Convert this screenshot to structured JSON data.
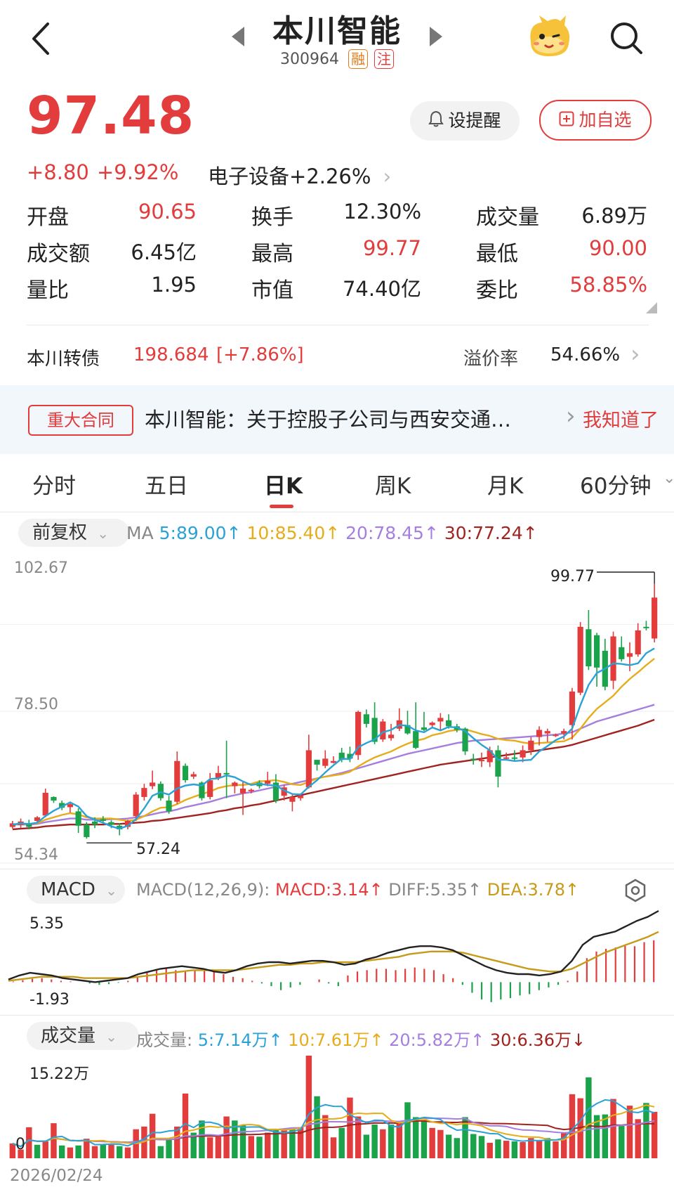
{
  "header": {
    "title": "本川智能",
    "code": "300964",
    "tag_margin": "融",
    "tag_note": "注"
  },
  "price": {
    "last": "97.48",
    "change": "+8.80",
    "change_pct": "+9.92%",
    "sector": "电子设备",
    "sector_pct": "+2.26%"
  },
  "buttons": {
    "remind": "设提醒",
    "add": "加自选"
  },
  "stats": [
    {
      "label": "开盘",
      "value": "90.65",
      "color": "red"
    },
    {
      "label": "换手",
      "value": "12.30%",
      "color": "black"
    },
    {
      "label": "成交量",
      "value": "6.89万",
      "color": "black"
    },
    {
      "label": "成交额",
      "value": "6.45亿",
      "color": "black"
    },
    {
      "label": "最高",
      "value": "99.77",
      "color": "red"
    },
    {
      "label": "最低",
      "value": "90.00",
      "color": "red"
    },
    {
      "label": "量比",
      "value": "1.95",
      "color": "black"
    },
    {
      "label": "市值",
      "value": "74.40亿",
      "color": "black"
    },
    {
      "label": "委比",
      "value": "58.85%",
      "color": "red"
    }
  ],
  "bond": {
    "name": "本川转债",
    "price": "198.684",
    "pct": "[+7.86%]",
    "premium_label": "溢价率",
    "premium": "54.66%"
  },
  "notice": {
    "tag": "重大合同",
    "text": "本川智能：关于控股子公司与西安交通…",
    "action": "我知道了"
  },
  "tabs": [
    "分时",
    "五日",
    "日K",
    "周K",
    "月K",
    "60分钟"
  ],
  "kline": {
    "adjust": "前复权",
    "ma_label": "MA",
    "ma5": "5:89.00",
    "ma10": "10:85.40",
    "ma20": "20:78.45",
    "ma30": "30:77.24",
    "y_top": "102.67",
    "y_mid": "78.50",
    "y_bot": "54.34",
    "hi_label": "99.77",
    "lo_label": "57.24"
  },
  "macd": {
    "dropdown": "MACD",
    "params": "MACD(12,26,9):",
    "macd_val": "MACD:3.14",
    "diff_val": "DIFF:5.35",
    "dea_val": "DEA:3.78",
    "y_top": "5.35",
    "y_bot": "-1.93"
  },
  "volume": {
    "dropdown": "成交量",
    "label": "成交量:",
    "v5": "5:7.14万",
    "v10": "10:7.61万",
    "v20": "20:5.82万",
    "v30": "30:6.36万",
    "y_top": "15.22万",
    "y_bot": "0",
    "date": "2026/02/24"
  },
  "colors": {
    "up": "#e23c3c",
    "down": "#1aa34a",
    "ma5": "#2aa2d6",
    "ma10": "#e6ac1a",
    "ma20": "#a57fe0",
    "ma30": "#a0231f"
  },
  "chart_data": {
    "type": "candlestick",
    "ylim": [
      54.34,
      102.67
    ],
    "annotations": {
      "high": 99.77,
      "low": 57.24
    },
    "candles": [
      [
        59.2,
        59.8,
        58.9,
        60.2
      ],
      [
        59.5,
        60.1,
        59.0,
        60.6
      ],
      [
        59.8,
        59.2,
        58.8,
        60.4
      ],
      [
        60.2,
        60.8,
        59.8,
        61.0
      ],
      [
        61.1,
        64.9,
        60.8,
        65.6
      ],
      [
        64.2,
        63.6,
        63.2,
        64.3
      ],
      [
        63.2,
        62.4,
        62.0,
        63.6
      ],
      [
        62.5,
        63.0,
        61.6,
        63.4
      ],
      [
        61.8,
        59.4,
        58.2,
        62.3
      ],
      [
        59.6,
        57.5,
        57.24,
        60.0
      ],
      [
        60.1,
        59.6,
        59.0,
        60.8
      ],
      [
        60.5,
        60.2,
        59.8,
        61.0
      ],
      [
        60.0,
        59.6,
        59.0,
        60.3
      ],
      [
        59.4,
        58.8,
        57.8,
        59.8
      ],
      [
        59.2,
        60.2,
        58.8,
        60.4
      ],
      [
        61.0,
        64.6,
        60.2,
        65.0
      ],
      [
        64.2,
        65.7,
        63.6,
        66.4
      ],
      [
        66.0,
        66.6,
        65.5,
        68.6
      ],
      [
        66.4,
        64.0,
        63.6,
        66.8
      ],
      [
        63.6,
        61.8,
        61.4,
        64.4
      ],
      [
        63.4,
        70.2,
        63.0,
        71.8
      ],
      [
        69.4,
        67.0,
        66.6,
        69.8
      ],
      [
        67.6,
        68.0,
        67.2,
        68.4
      ],
      [
        66.6,
        64.0,
        63.6,
        66.8
      ],
      [
        64.2,
        67.0,
        63.8,
        68.2
      ],
      [
        67.4,
        68.2,
        67.0,
        69.4
      ],
      [
        68.2,
        68.0,
        64.0,
        73.6
      ],
      [
        66.0,
        66.6,
        64.8,
        66.8
      ],
      [
        64.8,
        65.6,
        61.2,
        66.8
      ],
      [
        65.2,
        65.4,
        64.8,
        65.6
      ],
      [
        66.6,
        66.0,
        65.6,
        67.0
      ],
      [
        66.4,
        66.9,
        66.0,
        68.4
      ],
      [
        66.6,
        63.6,
        63.2,
        68.0
      ],
      [
        64.4,
        65.8,
        63.6,
        66.2
      ],
      [
        63.4,
        64.2,
        61.8,
        64.8
      ],
      [
        64.0,
        64.4,
        63.6,
        64.8
      ],
      [
        65.8,
        72.0,
        65.6,
        74.6
      ],
      [
        70.4,
        69.6,
        68.6,
        70.4
      ],
      [
        69.4,
        70.6,
        69.0,
        72.0
      ],
      [
        69.9,
        70.2,
        69.8,
        71.0
      ],
      [
        71.6,
        70.4,
        70.0,
        72.4
      ],
      [
        71.4,
        70.6,
        70.0,
        72.6
      ],
      [
        71.2,
        78.4,
        70.4,
        78.6
      ],
      [
        78.0,
        76.4,
        75.8,
        78.8
      ],
      [
        77.4,
        73.4,
        73.0,
        80.0
      ],
      [
        73.8,
        76.8,
        73.4,
        77.2
      ],
      [
        74.0,
        74.6,
        73.6,
        76.4
      ],
      [
        75.6,
        77.0,
        75.2,
        79.0
      ],
      [
        76.2,
        74.8,
        74.6,
        78.6
      ],
      [
        75.2,
        72.4,
        72.2,
        80.0
      ],
      [
        75.8,
        75.4,
        75.2,
        78.4
      ],
      [
        76.2,
        76.6,
        75.8,
        76.8
      ],
      [
        76.8,
        77.4,
        75.2,
        78.2
      ],
      [
        77.0,
        76.0,
        75.6,
        78.0
      ],
      [
        76.0,
        75.4,
        75.0,
        76.4
      ],
      [
        75.6,
        71.8,
        71.2,
        75.8
      ],
      [
        70.6,
        70.4,
        69.6,
        71.4
      ],
      [
        70.4,
        70.4,
        69.2,
        71.6
      ],
      [
        70.0,
        72.0,
        69.2,
        72.6
      ],
      [
        72.0,
        67.6,
        65.8,
        72.8
      ],
      [
        70.6,
        70.8,
        70.4,
        71.6
      ],
      [
        70.8,
        70.6,
        70.2,
        72.0
      ],
      [
        70.8,
        72.0,
        70.0,
        72.8
      ],
      [
        72.0,
        73.6,
        71.2,
        74.2
      ],
      [
        74.2,
        75.4,
        72.8,
        76.0
      ],
      [
        74.8,
        75.2,
        73.4,
        75.6
      ],
      [
        74.4,
        74.6,
        74.2,
        74.8
      ],
      [
        74.8,
        75.2,
        73.8,
        75.6
      ],
      [
        76.2,
        81.8,
        73.8,
        82.4
      ],
      [
        81.6,
        92.6,
        81.2,
        93.4
      ],
      [
        92.2,
        86.0,
        85.4,
        95.4
      ],
      [
        91.2,
        85.8,
        82.6,
        91.6
      ],
      [
        88.6,
        82.6,
        82.0,
        90.6
      ],
      [
        83.6,
        91.0,
        82.2,
        91.8
      ],
      [
        89.2,
        87.2,
        86.8,
        91.0
      ],
      [
        87.6,
        88.2,
        85.2,
        90.0
      ],
      [
        88.0,
        92.0,
        87.6,
        93.2
      ],
      [
        92.6,
        92.4,
        92.0,
        93.6
      ],
      [
        90.65,
        97.48,
        90.0,
        99.77
      ]
    ],
    "ma5": [
      59.6,
      59.8,
      59.7,
      59.9,
      61.0,
      61.9,
      62.6,
      63.3,
      62.6,
      61.0,
      60.4,
      59.9,
      59.3,
      58.9,
      59.4,
      60.5,
      62.3,
      64.4,
      65.0,
      64.6,
      65.6,
      66.1,
      66.3,
      66.1,
      67.2,
      67.3,
      67.8,
      67.5,
      66.8,
      66.2,
      66.4,
      66.2,
      66.1,
      65.3,
      64.7,
      64.6,
      65.9,
      67.0,
      68.3,
      69.5,
      70.6,
      70.5,
      72.5,
      73.2,
      73.8,
      75.0,
      75.4,
      76.2,
      76.1,
      75.3,
      75.0,
      75.8,
      75.3,
      75.9,
      75.8,
      75.2,
      74.0,
      72.9,
      72.0,
      70.4,
      70.4,
      70.2,
      70.3,
      70.4,
      71.8,
      72.7,
      73.7,
      74.3,
      75.6,
      79.5,
      82.9,
      84.9,
      85.6,
      86.5,
      86.4,
      86.2,
      86.5,
      88.2,
      89.0
    ],
    "ma10": [
      59.6,
      59.7,
      59.7,
      59.8,
      60.4,
      60.8,
      61.2,
      61.5,
      61.3,
      60.8,
      60.6,
      60.6,
      60.6,
      60.4,
      60.2,
      60.4,
      61.0,
      61.8,
      62.4,
      62.5,
      63.0,
      63.7,
      64.2,
      64.7,
      65.1,
      65.7,
      66.0,
      66.2,
      66.2,
      66.4,
      66.8,
      66.9,
      67.0,
      66.7,
      66.3,
      66.2,
      66.7,
      67.3,
      67.6,
      67.8,
      68.0,
      68.4,
      69.3,
      70.1,
      70.8,
      71.3,
      71.8,
      72.5,
      73.1,
      73.6,
      73.9,
      74.5,
      74.8,
      75.2,
      75.4,
      75.5,
      75.1,
      74.7,
      74.4,
      73.9,
      73.7,
      73.6,
      73.3,
      73.1,
      73.2,
      73.3,
      73.4,
      73.5,
      74.1,
      75.6,
      77.4,
      78.9,
      80.0,
      81.1,
      82.6,
      83.9,
      85.0,
      86.2,
      87.3
    ],
    "ma20": [
      59.6,
      59.6,
      59.6,
      59.7,
      60.0,
      60.2,
      60.4,
      60.6,
      60.6,
      60.4,
      60.4,
      60.4,
      60.5,
      60.5,
      60.6,
      60.8,
      61.0,
      61.3,
      61.6,
      61.8,
      62.1,
      62.5,
      62.8,
      63.1,
      63.4,
      63.8,
      64.2,
      64.5,
      64.8,
      65.0,
      65.3,
      65.6,
      65.9,
      66.2,
      66.4,
      66.7,
      67.0,
      67.3,
      67.6,
      67.9,
      68.2,
      68.6,
      69.0,
      69.4,
      69.8,
      70.2,
      70.6,
      71.0,
      71.4,
      71.7,
      72.0,
      72.3,
      72.6,
      72.9,
      73.2,
      73.4,
      73.6,
      73.7,
      73.8,
      73.9,
      74.0,
      74.1,
      74.2,
      74.3,
      74.4,
      74.5,
      74.6,
      74.8,
      75.0,
      75.6,
      76.2,
      76.8,
      77.2,
      77.6,
      78.0,
      78.4,
      78.8,
      79.2,
      79.6
    ],
    "ma30": [
      58.8,
      58.9,
      59.0,
      59.1,
      59.3,
      59.4,
      59.5,
      59.6,
      59.6,
      59.6,
      59.6,
      59.6,
      59.7,
      59.7,
      59.8,
      59.9,
      60.0,
      60.2,
      60.3,
      60.5,
      60.7,
      60.9,
      61.1,
      61.3,
      61.5,
      61.8,
      62.0,
      62.3,
      62.5,
      62.8,
      63.0,
      63.3,
      63.6,
      63.9,
      64.2,
      64.5,
      64.8,
      65.1,
      65.4,
      65.7,
      66.0,
      66.3,
      66.6,
      66.9,
      67.2,
      67.5,
      67.8,
      68.1,
      68.4,
      68.7,
      69.0,
      69.3,
      69.6,
      69.8,
      70.0,
      70.2,
      70.4,
      70.6,
      70.8,
      71.0,
      71.2,
      71.4,
      71.6,
      71.8,
      72.0,
      72.2,
      72.4,
      72.6,
      72.9,
      73.3,
      73.7,
      74.1,
      74.5,
      74.9,
      75.3,
      75.7,
      76.1,
      76.6,
      77.1
    ],
    "macd_ylim": [
      -1.93,
      5.35
    ],
    "macd_hist": [
      0.05,
      0.15,
      0.25,
      0.3,
      0.2,
      0.1,
      0.05,
      0.0,
      -0.1,
      -0.2,
      -0.15,
      -0.05,
      0.1,
      0.4,
      0.7,
      0.9,
      1.0,
      0.9,
      0.8,
      0.9,
      1.0,
      0.8,
      0.6,
      0.4,
      0.3,
      0.1,
      -0.1,
      -0.3,
      -0.6,
      -0.4,
      -0.2,
      0.0,
      0.2,
      -0.1,
      -0.3,
      0.5,
      0.8,
      0.9,
      1.0,
      1.0,
      0.9,
      1.0,
      1.1,
      1.0,
      0.9,
      0.6,
      0.3,
      -0.2,
      -0.8,
      -1.3,
      -1.5,
      -1.3,
      -1.2,
      -1.0,
      -0.9,
      -0.6,
      -0.4,
      -0.2,
      0.1,
      0.8,
      1.8,
      2.3,
      2.5,
      2.6,
      2.8,
      2.7,
      3.0,
      3.14
    ],
    "diff": [
      0.2,
      0.5,
      0.7,
      0.6,
      0.5,
      0.3,
      0.2,
      0.1,
      0.0,
      0.1,
      0.2,
      0.3,
      0.6,
      0.8,
      1.0,
      1.1,
      1.2,
      1.1,
      1.0,
      0.8,
      0.7,
      0.9,
      1.2,
      1.4,
      1.5,
      1.5,
      1.4,
      1.5,
      1.6,
      1.6,
      1.5,
      1.3,
      1.4,
      1.7,
      1.9,
      2.2,
      2.4,
      2.6,
      2.7,
      2.7,
      2.6,
      2.4,
      2.0,
      1.6,
      1.2,
      0.9,
      0.7,
      0.6,
      0.6,
      0.5,
      0.6,
      0.8,
      1.6,
      2.8,
      3.4,
      3.6,
      3.8,
      4.2,
      4.6,
      4.9,
      5.35
    ],
    "dea": [
      0.1,
      0.2,
      0.3,
      0.4,
      0.4,
      0.4,
      0.4,
      0.3,
      0.3,
      0.3,
      0.3,
      0.3,
      0.4,
      0.5,
      0.6,
      0.7,
      0.8,
      0.9,
      0.9,
      0.9,
      0.9,
      0.9,
      1.0,
      1.1,
      1.2,
      1.3,
      1.3,
      1.4,
      1.4,
      1.5,
      1.5,
      1.5,
      1.5,
      1.6,
      1.7,
      1.8,
      1.9,
      2.1,
      2.2,
      2.3,
      2.3,
      2.3,
      2.2,
      2.0,
      1.8,
      1.6,
      1.4,
      1.2,
      1.0,
      0.9,
      0.8,
      0.8,
      1.0,
      1.4,
      1.8,
      2.2,
      2.5,
      2.8,
      3.1,
      3.4,
      3.78
    ],
    "volume_ylim": [
      0,
      15.22
    ],
    "volume": [
      2.2,
      1.3,
      4.6,
      2.0,
      2.5,
      5.2,
      1.9,
      1.6,
      1.9,
      2.9,
      1.8,
      2.0,
      2.0,
      1.8,
      1.6,
      4.3,
      4.7,
      6.6,
      1.8,
      2.9,
      4.7,
      9.6,
      3.8,
      5.6,
      3.1,
      3.2,
      6.2,
      5.6,
      4.9,
      3.3,
      3.2,
      3.8,
      4.2,
      4.3,
      4.3,
      4.6,
      15.22,
      9.2,
      6.4,
      3.1,
      4.5,
      9.0,
      6.2,
      3.5,
      5.0,
      4.3,
      5.0,
      5.3,
      8.3,
      6.1,
      5.6,
      4.5,
      4.2,
      3.5,
      3.0,
      6.1,
      3.6,
      3.3,
      2.3,
      2.8,
      2.6,
      2.5,
      2.4,
      3.0,
      2.6,
      3.0,
      2.5,
      3.8,
      9.5,
      8.9,
      12.0,
      6.4,
      6.5,
      8.8,
      5.0,
      7.8,
      5.8,
      8.2,
      6.89
    ],
    "vol_up": [
      1,
      1,
      1,
      0,
      1,
      1,
      0,
      1,
      0,
      1,
      1,
      0,
      1,
      0,
      1,
      1,
      1,
      1,
      0,
      0,
      1,
      1,
      0,
      0,
      1,
      1,
      1,
      0,
      0,
      1,
      0,
      1,
      0,
      1,
      0,
      1,
      1,
      0,
      1,
      1,
      0,
      1,
      1,
      0,
      0,
      1,
      0,
      1,
      0,
      0,
      0,
      1,
      1,
      0,
      0,
      0,
      0,
      0,
      1,
      0,
      1,
      0,
      1,
      1,
      1,
      0,
      1,
      1,
      1,
      1,
      0,
      0,
      0,
      1,
      0,
      1,
      1,
      0,
      1
    ]
  }
}
